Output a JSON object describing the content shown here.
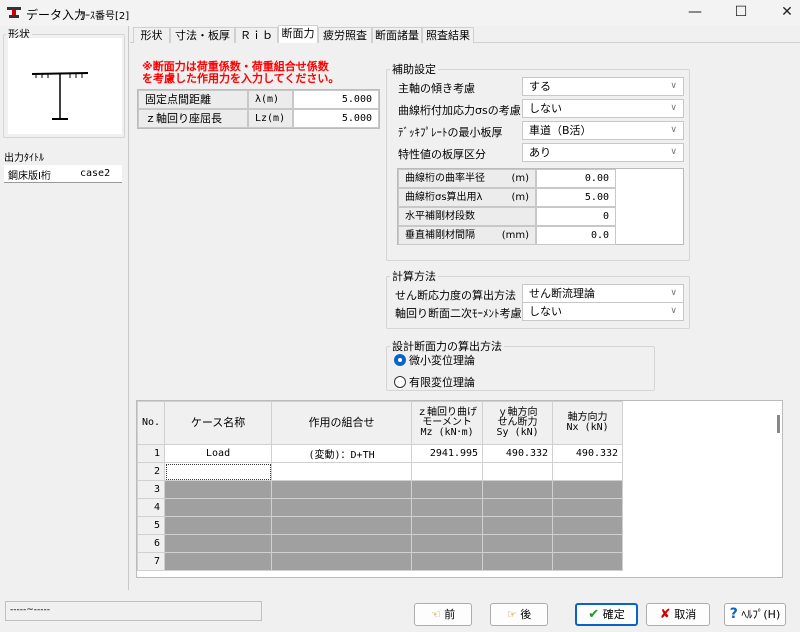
{
  "window": {
    "title": "データ入力",
    "case_label": "ｹｰｽ番号[2]",
    "minimize": "—",
    "maximize": "☐",
    "close": "✕"
  },
  "left": {
    "shape_group": "形状",
    "output_title_label": "出力ﾀｲﾄﾙ",
    "output_title_name": "鋼床版I桁",
    "output_title_case": "case2"
  },
  "tabs": [
    {
      "label": "形状"
    },
    {
      "label": "寸法・板厚"
    },
    {
      "label": "Ｒｉｂ"
    },
    {
      "label": "断面力",
      "active": true
    },
    {
      "label": "疲労照査"
    },
    {
      "label": "断面諸量"
    },
    {
      "label": "照査結果"
    }
  ],
  "note": {
    "line1": "※断面力は荷重係数・荷重組合せ係数",
    "line2": "を考慮した作用力を入力してください。",
    "color": "#ff0000"
  },
  "buckling": [
    {
      "label": "固定点間距離",
      "unit": "λ(m)",
      "value": "5.000"
    },
    {
      "label": "ｚ軸回り座屈長",
      "unit": "Lz(m)",
      "value": "5.000"
    }
  ],
  "aux": {
    "title": "補助設定",
    "rows": [
      {
        "label": "主軸の傾き考慮",
        "value": "する"
      },
      {
        "label": "曲線桁付加応力σsの考慮",
        "value": "しない"
      },
      {
        "label": "ﾃﾞｯｷﾌﾟﾚｰﾄの最小板厚",
        "value": "車道（B活）"
      },
      {
        "label": "特性値の板厚区分",
        "value": "あり"
      }
    ],
    "grid": [
      {
        "label": "曲線桁の曲率半径",
        "unit": "(m)",
        "value": "0.00"
      },
      {
        "label": "曲線桁σs算出用λ",
        "unit": "(m)",
        "value": "5.00"
      },
      {
        "label": "水平補剛材段数",
        "unit": "",
        "value": "0"
      },
      {
        "label": "垂直補剛材間隔",
        "unit": "(mm)",
        "value": "0.0"
      }
    ]
  },
  "calc": {
    "title": "計算方法",
    "rows": [
      {
        "label": "せん断応力度の算出方法",
        "value": "せん断流理論"
      },
      {
        "label": "軸回り断面二次ﾓｰﾒﾝﾄ考慮",
        "value": "しない"
      }
    ]
  },
  "design": {
    "title": "設計断面力の算出方法",
    "options": [
      {
        "label": "微小変位理論",
        "selected": true
      },
      {
        "label": "有限変位理論",
        "selected": false
      }
    ]
  },
  "table": {
    "headers": {
      "no": "No.",
      "name": "ケース名称",
      "combo": "作用の組合せ",
      "mz": [
        "ｚ軸回り曲げ",
        "モーメント",
        "Mz (kN･m)"
      ],
      "sy": [
        "ｙ軸方向",
        "せん断力",
        "Sy (kN)"
      ],
      "nx": [
        "軸方向力",
        "Nx (kN)"
      ]
    },
    "rows": [
      {
        "no": "1",
        "name": "Load",
        "combo": "(変動)：D+TH",
        "mz": "2941.995",
        "sy": "490.332",
        "nx": "490.332"
      },
      {
        "no": "2"
      },
      {
        "no": "3"
      },
      {
        "no": "4"
      },
      {
        "no": "5"
      },
      {
        "no": "6"
      },
      {
        "no": "7"
      }
    ]
  },
  "status": {
    "text": "-----~-----"
  },
  "buttons": {
    "prev": "前",
    "next": "後",
    "ok": "確定",
    "cancel": "取消",
    "help": "ﾍﾙﾌﾟ(H)"
  },
  "colors": {
    "ok_border": "#0a64c8",
    "radio": "#0a64c8",
    "gray_row": "#a0a0a0"
  }
}
